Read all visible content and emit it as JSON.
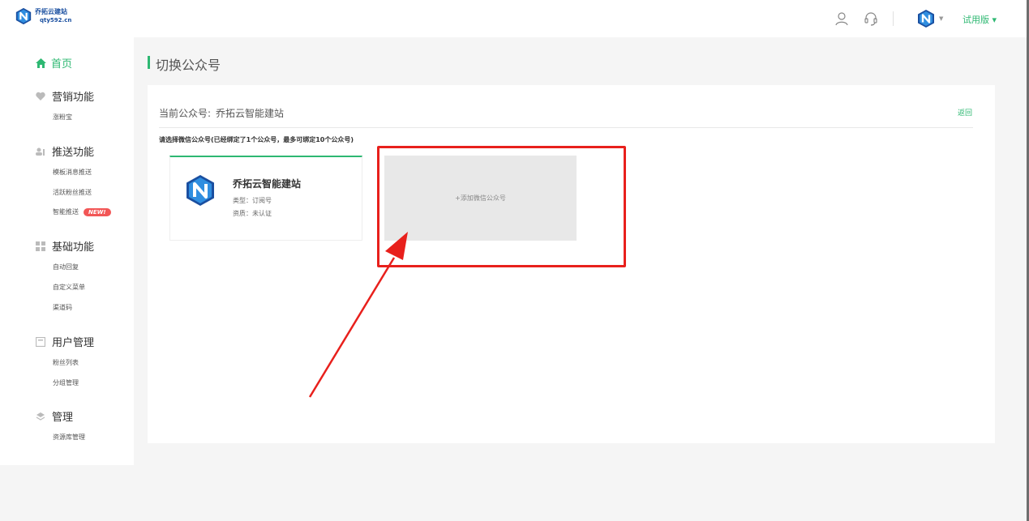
{
  "header": {
    "logo_name": "乔拓云建站",
    "logo_domain": "qty592.cn",
    "user_icon": "user-icon",
    "support_icon": "headset-icon",
    "plan_label": "试用版 ▾"
  },
  "sidebar": {
    "home_label": "首页",
    "groups": [
      {
        "title": "营销功能",
        "icon": "heart-icon",
        "items": [
          "涨粉宝"
        ]
      },
      {
        "title": "推送功能",
        "icon": "users-icon",
        "items": [
          "模板消息推送",
          "活跃粉丝推送",
          "智能推送"
        ]
      },
      {
        "title": "基础功能",
        "icon": "grid-icon",
        "items": [
          "自动回复",
          "自定义菜单",
          "渠道码"
        ]
      },
      {
        "title": "用户管理",
        "icon": "book-icon",
        "items": [
          "粉丝列表",
          "分组管理"
        ]
      },
      {
        "title": "管理",
        "icon": "layers-icon",
        "items": [
          "资源库管理"
        ]
      }
    ],
    "new_badge": "NEW!"
  },
  "main": {
    "page_title": "切换公众号",
    "current_label": "当前公众号:",
    "current_value": "乔拓云智能建站",
    "back_label": "返回",
    "hint": "请选择微信公众号(已经绑定了1个公众号，最多可绑定10个公众号)",
    "account": {
      "name": "乔拓云智能建站",
      "type": "类型：订阅号",
      "cert": "资质：未认证"
    },
    "add_label": "+添加微信公众号"
  },
  "colors": {
    "accent": "#2eb872",
    "brand": "#1a4fa0",
    "highlight": "#e8201c",
    "badge": "#f25656"
  }
}
